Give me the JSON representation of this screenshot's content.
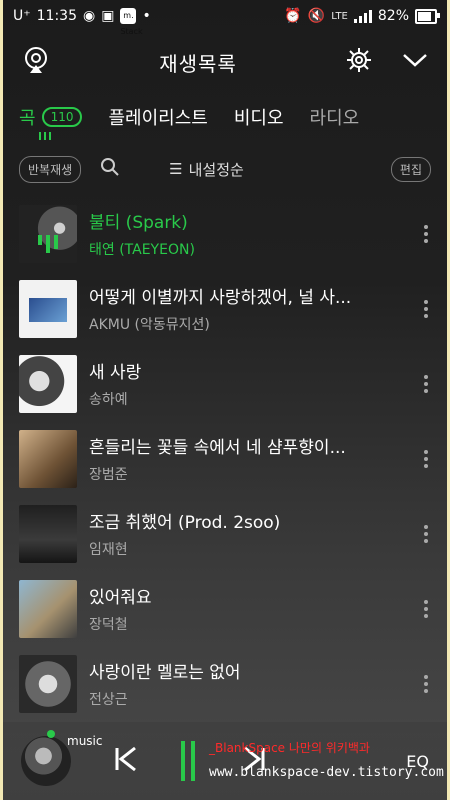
{
  "status": {
    "carrier": "U⁺",
    "time": "11:35",
    "tag_label": "m.\nStack",
    "network": "LTE",
    "battery": "82%"
  },
  "header": {
    "title": "재생목록"
  },
  "tabs": {
    "songs": "곡",
    "songs_count": "110",
    "playlist": "플레이리스트",
    "video": "비디오",
    "radio": "라디오"
  },
  "controls": {
    "repeat": "반복재생",
    "sort": "내설정순",
    "edit": "편집"
  },
  "songs": [
    {
      "title": "불티 (Spark)",
      "artist": "태연 (TAEYEON)"
    },
    {
      "title": "어떻게 이별까지 사랑하겠어, 널 사...",
      "artist": "AKMU (악동뮤지션)"
    },
    {
      "title": "새 사랑",
      "artist": "송하예"
    },
    {
      "title": "흔들리는 꽃들 속에서 네 샴푸향이...",
      "artist": "장범준"
    },
    {
      "title": "조금 취했어 (Prod. 2soo)",
      "artist": "임재현"
    },
    {
      "title": "있어줘요",
      "artist": "장덕철"
    },
    {
      "title": "사랑이란 멜로는 없어",
      "artist": "전상근"
    }
  ],
  "player": {
    "music_label": "music",
    "eq_label": "EQ"
  },
  "watermark": {
    "line1": "_BlankSpace 나만의 위키백과",
    "line2": "www.blankspace-dev.tistory.com"
  },
  "colors": {
    "accent": "#29c94a",
    "background": "#202020"
  },
  "icons": {
    "cast": "cast-icon",
    "settings": "gear-icon",
    "collapse": "chevron-down-icon",
    "search": "search-icon",
    "sort": "sort-icon",
    "prev": "skip-previous-icon",
    "next": "skip-next-icon",
    "pause": "pause-icon",
    "more": "more-vert-icon"
  }
}
